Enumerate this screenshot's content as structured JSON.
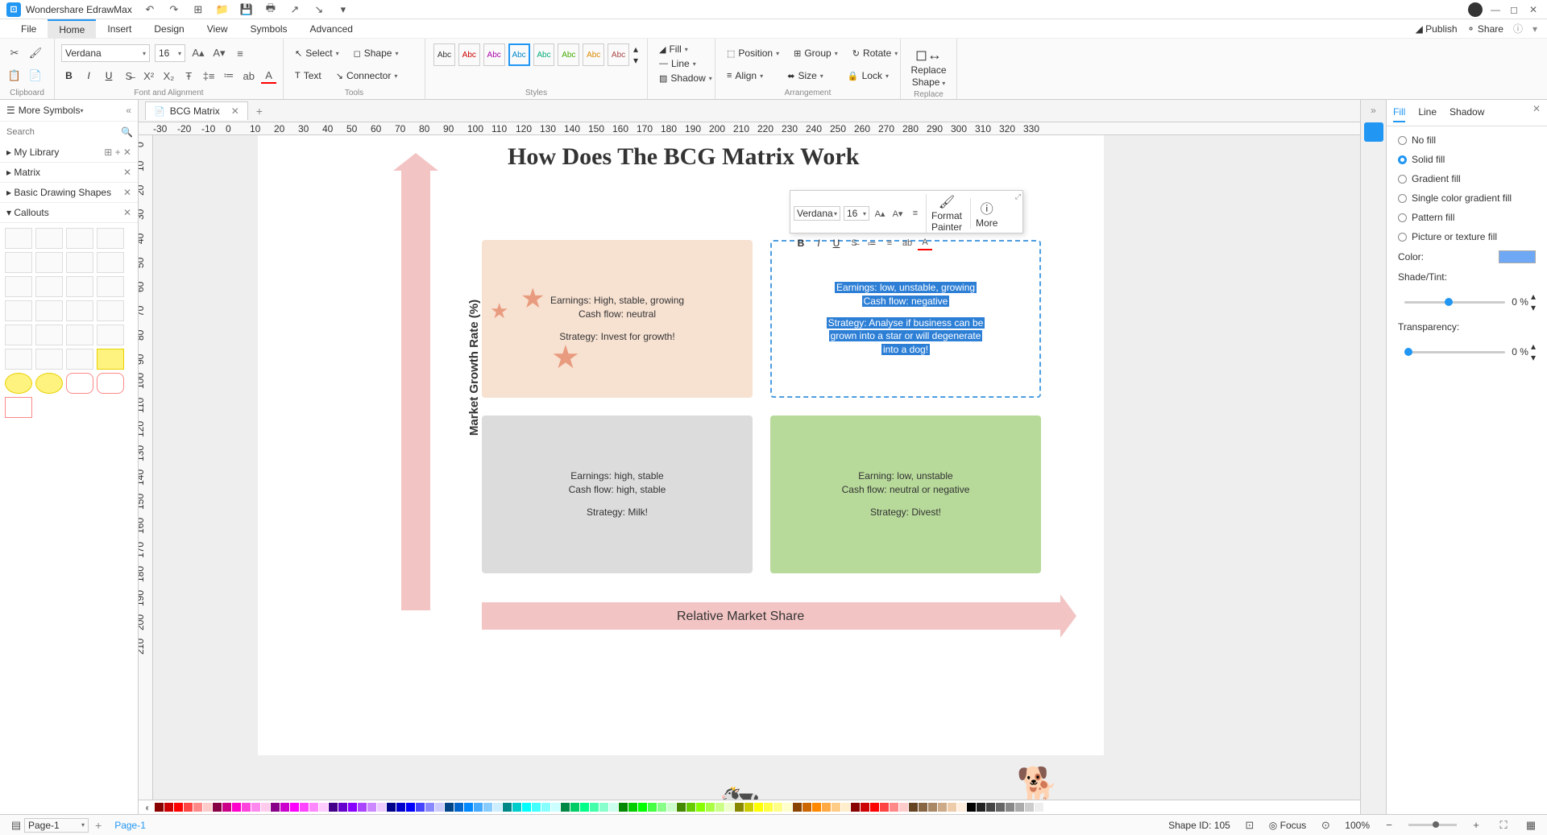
{
  "app": {
    "title": "Wondershare EdrawMax"
  },
  "menu": {
    "file": "File",
    "home": "Home",
    "insert": "Insert",
    "design": "Design",
    "view": "View",
    "symbols": "Symbols",
    "advanced": "Advanced",
    "publish": "Publish",
    "share": "Share"
  },
  "ribbon": {
    "clipboard": "Clipboard",
    "font_alignment": "Font and Alignment",
    "tools": "Tools",
    "styles": "Styles",
    "arrangement": "Arrangement",
    "replace": "Replace",
    "font": "Verdana",
    "size": "16",
    "select": "Select",
    "shape": "Shape",
    "text": "Text",
    "connector": "Connector",
    "abc": "Abc",
    "fill": "Fill",
    "line": "Line",
    "shadow": "Shadow",
    "position": "Position",
    "align": "Align",
    "group": "Group",
    "size_btn": "Size",
    "rotate": "Rotate",
    "lock": "Lock",
    "replace_shape": "Replace\nShape"
  },
  "left": {
    "title": "More Symbols",
    "search": "Search",
    "my_library": "My Library",
    "matrix": "Matrix",
    "basic": "Basic Drawing Shapes",
    "callouts": "Callouts"
  },
  "tabs": {
    "doc": "BCG Matrix"
  },
  "ruler": {
    "marks": [
      "-30",
      "-20",
      "-10",
      "0",
      "10",
      "20",
      "30",
      "40",
      "50",
      "60",
      "70",
      "80",
      "90",
      "100",
      "110",
      "120",
      "130",
      "140",
      "150",
      "160",
      "170",
      "180",
      "190",
      "200",
      "210",
      "220",
      "230",
      "240",
      "250",
      "260",
      "270",
      "280",
      "290",
      "300",
      "310",
      "320",
      "330"
    ]
  },
  "ruler_v": {
    "marks": [
      "0",
      "10",
      "20",
      "30",
      "40",
      "50",
      "60",
      "70",
      "80",
      "90",
      "100",
      "110",
      "120",
      "130",
      "140",
      "150",
      "160",
      "170",
      "180",
      "190",
      "200",
      "210"
    ]
  },
  "diagram": {
    "title": "How Does The BCG Matrix Work",
    "ylabel": "Market Growth Rate (%)",
    "xlabel": "Relative Market Share",
    "q1_l1": "Earnings: High, stable, growing",
    "q1_l2": "Cash flow: neutral",
    "q1_l3": "Strategy: Invest for growth!",
    "q2_l1": "Earnings: low, unstable, growing",
    "q2_l2": "Cash flow: negative",
    "q2_l3": "Strategy: Analyse if business can be",
    "q2_l4": "grown into a star or will degenerate",
    "q2_l5": "into a dog!",
    "q3_l1": "Earnings: high, stable",
    "q3_l2": "Cash flow: high, stable",
    "q3_l3": "Strategy: Milk!",
    "q4_l1": "Earning: low, unstable",
    "q4_l2": "Cash flow: neutral or negative",
    "q4_l3": "Strategy: Divest!"
  },
  "float": {
    "font": "Verdana",
    "size": "16",
    "format": "Format\nPainter",
    "more": "More"
  },
  "right": {
    "fill": "Fill",
    "line": "Line",
    "shadow": "Shadow",
    "no_fill": "No fill",
    "solid": "Solid fill",
    "gradient": "Gradient fill",
    "single": "Single color gradient fill",
    "pattern": "Pattern fill",
    "texture": "Picture or texture fill",
    "color": "Color:",
    "shade": "Shade/Tint:",
    "transparency": "Transparency:",
    "pct0": "0 %"
  },
  "status": {
    "page_sel": "Page-1",
    "page_tab": "Page-1",
    "shape_id": "Shape ID: 105",
    "focus": "Focus",
    "zoom": "100%"
  }
}
